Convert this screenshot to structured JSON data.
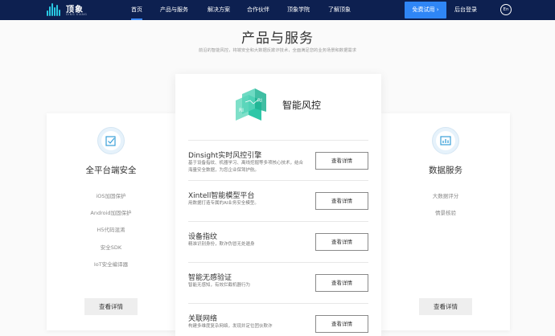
{
  "nav": {
    "logo_text": "顶象",
    "logo_sub": "DING XIANG",
    "items": [
      {
        "label": "首页"
      },
      {
        "label": "产品与服务"
      },
      {
        "label": "解决方案"
      },
      {
        "label": "合作伙伴"
      },
      {
        "label": "顶象学院"
      },
      {
        "label": "了解顶象"
      }
    ],
    "trial_label": "免费试用",
    "login_label": "后台登录",
    "lang_label": "En"
  },
  "section": {
    "title": "产品与服务",
    "subtitle": "前沿的智能风控，将端安全和大数据反欺诈技术，全面满足您的业务场景和数据需求"
  },
  "left_card": {
    "icon": "shield-check-icon",
    "title": "全平台端安全",
    "items": [
      "iOS加固保护",
      "Android加固保护",
      "H5代码混淆",
      "安全SDK",
      "IoT安全编译器"
    ],
    "button_label": "查看详情"
  },
  "center_card": {
    "logo_icon": "risk-control-logo-icon",
    "title": "智能风控",
    "products": [
      {
        "name": "Dinsight实时风控引擎",
        "desc": "基于设备指纹、机器学习、离线挖掘等多项核心技术，结合海量安全数据，为您企业保驾护航。",
        "button_label": "查看详情"
      },
      {
        "name": "Xintell智能模型平台",
        "desc": "用数据打造专属的AI业务安全模型。",
        "button_label": "查看详情"
      },
      {
        "name": "设备指纹",
        "desc": "精准识别身份，欺诈伪冒无处遁身",
        "button_label": "查看详情"
      },
      {
        "name": "智能无感验证",
        "desc": "智能无感知，有效拦截机器行为",
        "button_label": "查看详情"
      },
      {
        "name": "关联网络",
        "desc": "构建多维度复杂网络，发现并定位团伙欺诈",
        "button_label": "查看详情"
      }
    ]
  },
  "right_card": {
    "icon": "bar-chart-icon",
    "title": "数据服务",
    "items": [
      "大数据评分",
      "情景核验"
    ],
    "button_label": "查看详情"
  },
  "colors": {
    "nav_bg": "#0d2050",
    "accent": "#2f86f6",
    "brand_green": "#2ec7a8"
  }
}
